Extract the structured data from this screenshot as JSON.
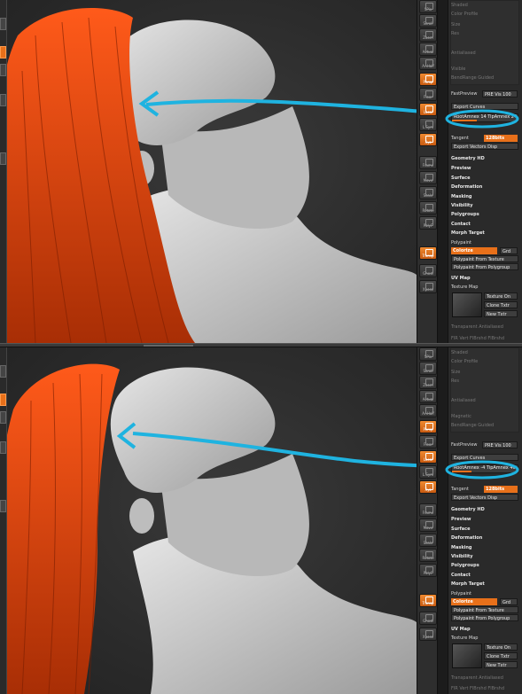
{
  "toolbar": {
    "buttons": [
      "SPix",
      "Scroll",
      "Zoom",
      "Actual",
      "AAHalf",
      "Persp",
      "Floor",
      "Local",
      "L.Sym",
      "Xyz",
      "Frame",
      "Move",
      "Scale",
      "Rotate",
      "PolyF",
      "Transp",
      "Ghost",
      "Solo",
      "Xpose"
    ]
  },
  "panel": {
    "faded_top": [
      "Shaded",
      "Color Profile",
      "Size",
      "Res",
      "Quad Stroke",
      "Transparent",
      "Antialiased",
      "Visible",
      "Magnetic",
      "BendRange Guided"
    ],
    "fast_preview_label": "FastPreview",
    "fast_preview_value": "PRE Vis 100",
    "export_curves": "Export Curves",
    "root_tip_top": "RootAmnex 14 TipAmnex 24",
    "root_tip_bottom": "RootAmnex -4 TipAmnex 40",
    "tangent_label": "Tangent",
    "tangent_value": "128bits",
    "export_vectors": "Export Vectors Disp",
    "menu": [
      "Geometry HD",
      "Preview",
      "Surface",
      "Deformation",
      "Masking",
      "Visibility",
      "Polygroups",
      "Contact",
      "Morph Target",
      "Polypaint"
    ],
    "colorize": "Colorize",
    "grd": "Grd",
    "polypaint_from_texture": "Polypaint From Texture",
    "polypaint_from_polygroup": "Polypaint From Polygroup",
    "uv_map": "UV Map",
    "texture_map": "Texture Map",
    "texture_on": "Texture On",
    "clone_txtr": "Clone Txtr",
    "new_txtr": "New Txtr",
    "faded_bottom": "Transparent Antialiased",
    "faded_bottom2": "FlR Vert FlBrshd FlBrshd"
  },
  "colors": {
    "accent": "#e8701a",
    "annotation": "#1fb3e0",
    "hair": "#d9420f",
    "skin": "#c9c9c9"
  }
}
